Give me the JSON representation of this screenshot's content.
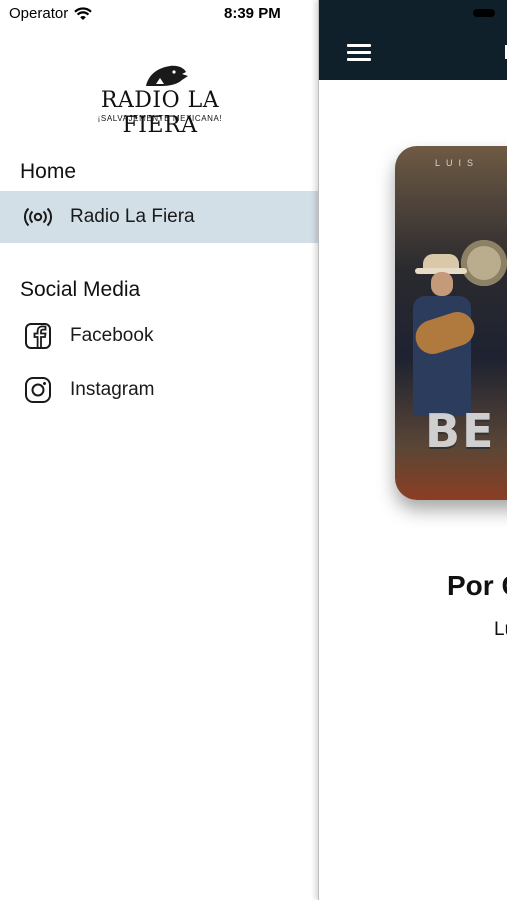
{
  "status_bar": {
    "carrier": "Operator",
    "time": "8:39 PM",
    "wifi_icon": "wifi-icon"
  },
  "logo": {
    "title": "RADIO LA FIERA",
    "subtitle": "¡SALVAJEMENTE MEXICANA!"
  },
  "drawer": {
    "sections": [
      {
        "title": "Home",
        "items": [
          {
            "label": "Radio La Fiera",
            "icon": "radio-broadcast-icon",
            "active": true
          }
        ]
      },
      {
        "title": "Social Media",
        "items": [
          {
            "label": "Facebook",
            "icon": "facebook-icon",
            "active": false
          },
          {
            "label": "Instagram",
            "icon": "instagram-icon",
            "active": false
          }
        ]
      }
    ]
  },
  "main": {
    "menu_icon": "hamburger-menu-icon",
    "cover": {
      "top_text": "LUIS",
      "big_text": "BE"
    },
    "song_title": "Por C",
    "song_artist": "Lu"
  },
  "colors": {
    "header_bg": "#10202a",
    "active_item_bg": "#d3dfe6"
  }
}
